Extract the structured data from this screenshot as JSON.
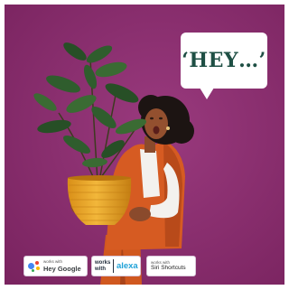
{
  "speech_bubble": {
    "text": "‘HEY…’"
  },
  "badges": {
    "google": {
      "small": "works with",
      "brand": "Hey Google"
    },
    "alexa": {
      "works_line1": "works",
      "works_line2": "with",
      "brand": "alexa"
    },
    "siri": {
      "small": "works with",
      "brand": "Siri Shortcuts"
    }
  },
  "colors": {
    "background_purple": "#8a2c6e",
    "bubble_text_green": "#1e4f44",
    "vest_orange": "#d65b22",
    "planter_yellow": "#e8a524",
    "leaf_green": "#2f5d2d",
    "alexa_blue": "#1fa2d8"
  },
  "icons": {
    "google_assistant": "google-assistant-dots-icon"
  }
}
